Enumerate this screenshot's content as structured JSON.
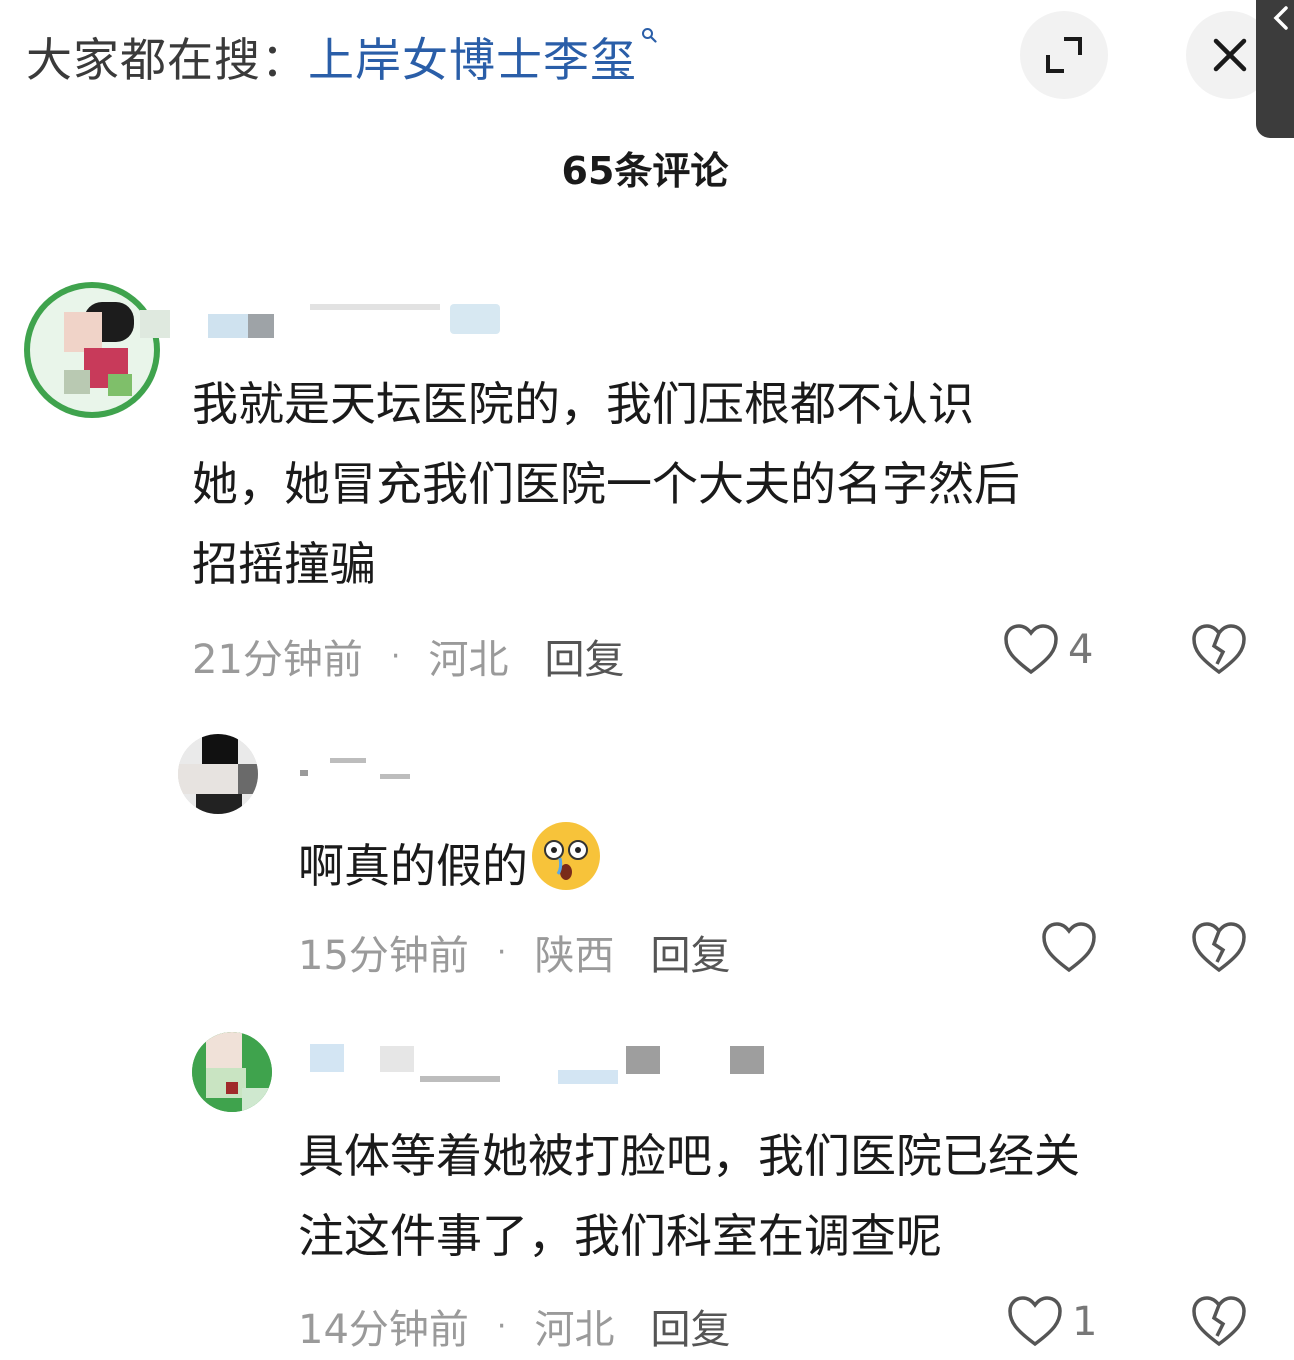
{
  "header": {
    "search_prefix": "大家都在搜：",
    "search_keyword": "上岸女博士李玺"
  },
  "comments_title": "65条评论",
  "comments": [
    {
      "text_lines": [
        "我就是天坛医院的，我们压根都不认识",
        "她，她冒充我们医院一个大夫的名字然后",
        "招摇撞骗"
      ],
      "time": "21分钟前",
      "location": "河北",
      "reply_label": "回复",
      "likes": "4"
    },
    {
      "text": "啊真的假的",
      "emoji": "surprised-face-emoji",
      "time": "15分钟前",
      "location": "陕西",
      "reply_label": "回复",
      "likes": ""
    },
    {
      "text_lines": [
        "具体等着她被打脸吧，我们医院已经关",
        "注这件事了，我们科室在调查呢"
      ],
      "time": "14分钟前",
      "location": "河北",
      "reply_label": "回复",
      "likes": "1"
    }
  ],
  "colors": {
    "keyword": "#2a5ea8",
    "meta": "#9a9a9a",
    "avatar_green": "#3fa34d"
  },
  "icons": [
    "search-icon",
    "expand-icon",
    "close-icon",
    "back-chevron-icon",
    "heart-icon",
    "broken-heart-icon"
  ]
}
